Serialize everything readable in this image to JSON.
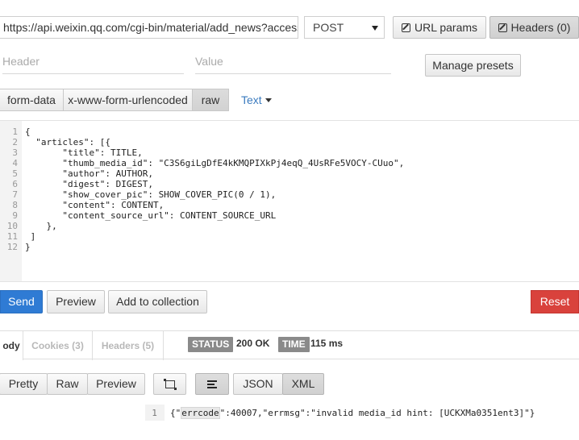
{
  "request": {
    "url": "https://api.weixin.qq.com/cgi-bin/material/add_news?access_token",
    "method": "POST",
    "url_params_label": "URL params",
    "headers_label": "Headers (0)"
  },
  "header_fields": {
    "key_placeholder": "Header",
    "value_placeholder": "Value",
    "manage_presets_label": "Manage presets"
  },
  "body_tabs": [
    {
      "label": "form-data"
    },
    {
      "label": "x-www-form-urlencoded"
    },
    {
      "label": "raw"
    }
  ],
  "body_type": "Text",
  "editor": {
    "line_numbers": [
      "1",
      "2",
      "3",
      "4",
      "5",
      "6",
      "7",
      "8",
      "9",
      "10",
      "11",
      "12"
    ],
    "lines": [
      "{",
      "  \"articles\": [{",
      "       \"title\": TITLE,",
      "       \"thumb_media_id\": \"C3S6giLgDfE4kKMQPIXkPj4eqQ_4UsRFe5VOCY-CUuo\",",
      "       \"author\": AUTHOR,",
      "       \"digest\": DIGEST,",
      "       \"show_cover_pic\": SHOW_COVER_PIC(0 / 1),",
      "       \"content\": CONTENT,",
      "       \"content_source_url\": CONTENT_SOURCE_URL",
      "    },",
      " ]",
      "}"
    ]
  },
  "actions": {
    "send": "Send",
    "preview": "Preview",
    "add_to_collection": "Add to collection",
    "reset": "Reset"
  },
  "response_tabs": [
    {
      "label": "ody"
    },
    {
      "label": "Cookies (3)"
    },
    {
      "label": "Headers (5)"
    }
  ],
  "response_status": {
    "status_label": "STATUS",
    "status_value": "200 OK",
    "time_label": "TIME",
    "time_value": "115 ms"
  },
  "response_view": {
    "pretty": "Pretty",
    "raw": "Raw",
    "preview": "Preview",
    "json": "JSON",
    "xml": "XML"
  },
  "response_body": {
    "line_number": "1",
    "prefix": "{\"",
    "highlight": "errcode",
    "suffix": "\":40007,\"errmsg\":\"invalid media_id hint: [UCKXMa0351ent3]\"}"
  },
  "colors": {
    "send": "#2f7bd4",
    "reset": "#d9423c",
    "text_dropdown": "#3b7bbf"
  }
}
